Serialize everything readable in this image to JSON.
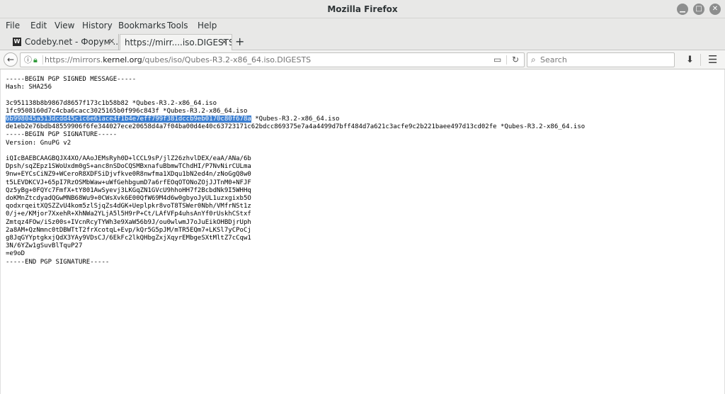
{
  "window": {
    "title": "Mozilla Firefox"
  },
  "menubar": [
    "File",
    "Edit",
    "View",
    "History",
    "Bookmarks",
    "Tools",
    "Help"
  ],
  "tabs": [
    {
      "label": "Codeby.net - Форум ...",
      "favicon": "W",
      "close": "✕"
    },
    {
      "label": "https://mirr....iso.DIGESTS",
      "close": "✕"
    }
  ],
  "new_tab": "+",
  "nav": {
    "url_prefix": "https://mirrors.",
    "url_host": "kernel.org",
    "url_path": "/qubes/iso/Qubes-R3.2-x86_64.iso.DIGESTS",
    "search_placeholder": "Search"
  },
  "document": {
    "header": "-----BEGIN PGP SIGNED MESSAGE-----\nHash: SHA256\n\n3c951138b8b9867d8657f173c1b58b82 *Qubes-R3.2-x86_64.iso\n1fc9508160d7c4cba6cacc3025165b0f996c843f *Qubes-R3.2-x86_64.iso",
    "highlighted": "6b998045a513dcdd45c1c6e61ace4f1b4e7eff799f381dccb9eb0170c80f678a",
    "highlighted_suffix": " *Qubes-R3.2-x86_64.iso",
    "body": "de1eb2e76bdb48559906f6fe344027ece20658d4a7f04ba00d4e40c63723171c62bdcc869375e7a4a4499d7bff484d7a621c3acfe9c2b221baee497d13cd02fe *Qubes-R3.2-x86_64.iso\n-----BEGIN PGP SIGNATURE-----\nVersion: GnuPG v2\n\niQIcBAEBCAAGBQJX4XO/AAoJEMsRyh0D+lCCL9sP/jlZ26zhvlDEX/eaA/ANa/6b\nDpsh/sqZEpz1SWoUxdm0gS+anc8nSDoCQSMBxnafuBbmwTChdHI/P7NvNirCULma\n9nw+EYCsCiNZ9+WCeroR8XDFSiDjvfkve0R8nwfma1XDqu1bN2ed4n/zNoGgQ8w0\nt5LEVDKCVJ+65pI7RzOSMbWaw+uWfGehbgumD7a6rfEOqOTONoZOjJJTnM0+NFJF\nQz5yBg+0FQYc7FmfX+tY801AwSyevj3LKGqZN1GVcU9hhoHH7f2BcbdNk9I5WHHq\ndoKMnZtcdyadQGwMNB68Wu9+0CWsXvk6E00QfW69M4d6w0gbyoJyUL1uzxgixb5O\nqodxrqeitXQSZZvU4kom5zlSjqZs4dGK+Ueplpkr8voT8TSWer0Nbh/VMfrNSt1z\n0/j+e/KMjor7XxehR+XhNWa2YLjA5l5H9rP+Ct/LAfVFp4uhsAnYf0rUskhCStxf\nZmtqz4FOw/iSz00s+IVcnRcyTYWh3e9XaW56b9J/ou0wlwmJ7oJuEikOHBDjrUph\n2a8AM+QzNmnc0tDBWTtT2frXcotqL+Evp/kQr5G5pJM/mTR5EQm7+LKSl7yCPoCj\ng8JqGYYptgkxjQdX3YAy9VDsCJ/6EkFc2lkQHbgZxjXqyrEMbgeSXtMltZ7cCqw1\n3N/6YZw1gSuvBlTquP27\n=e9oD\n-----END PGP SIGNATURE-----"
  }
}
